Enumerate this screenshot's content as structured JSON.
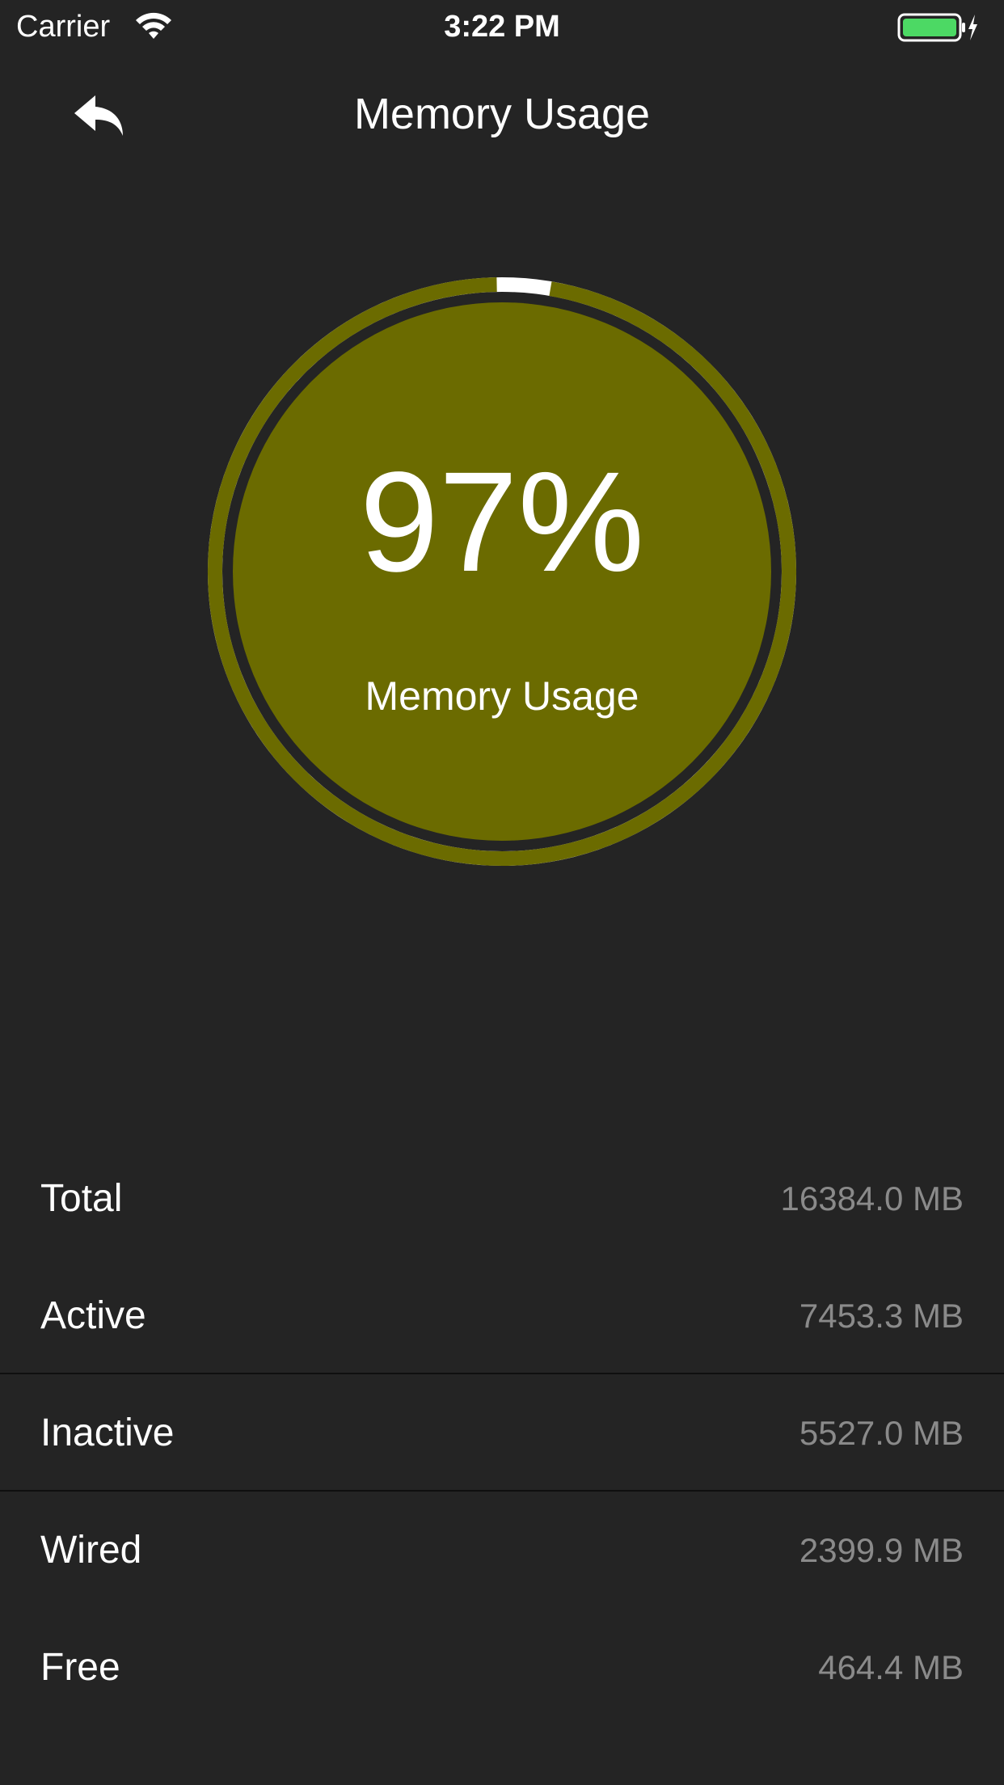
{
  "status_bar": {
    "carrier": "Carrier",
    "time": "3:22 PM",
    "icons": [
      "wifi-icon",
      "battery-charging-icon"
    ],
    "battery_color": "#4cd964"
  },
  "nav": {
    "title": "Memory Usage",
    "back_icon": "back-arrow-icon"
  },
  "gauge": {
    "percent_text": "97%",
    "label": "Memory Usage",
    "value_fraction": 0.97,
    "fill_color": "#6b6b00",
    "ring_color": "#6b6b00",
    "ring_remainder_color": "#ffffff"
  },
  "stats": [
    {
      "label": "Total",
      "value": "16384.0 MB"
    },
    {
      "label": "Active",
      "value": "7453.3 MB"
    },
    {
      "label": "Inactive",
      "value": "5527.0 MB"
    },
    {
      "label": "Wired",
      "value": "2399.9 MB"
    },
    {
      "label": "Free",
      "value": "464.4 MB"
    }
  ],
  "colors": {
    "background": "#242424",
    "divider": "#0f0f0f",
    "value_text": "#8a8a8a"
  }
}
